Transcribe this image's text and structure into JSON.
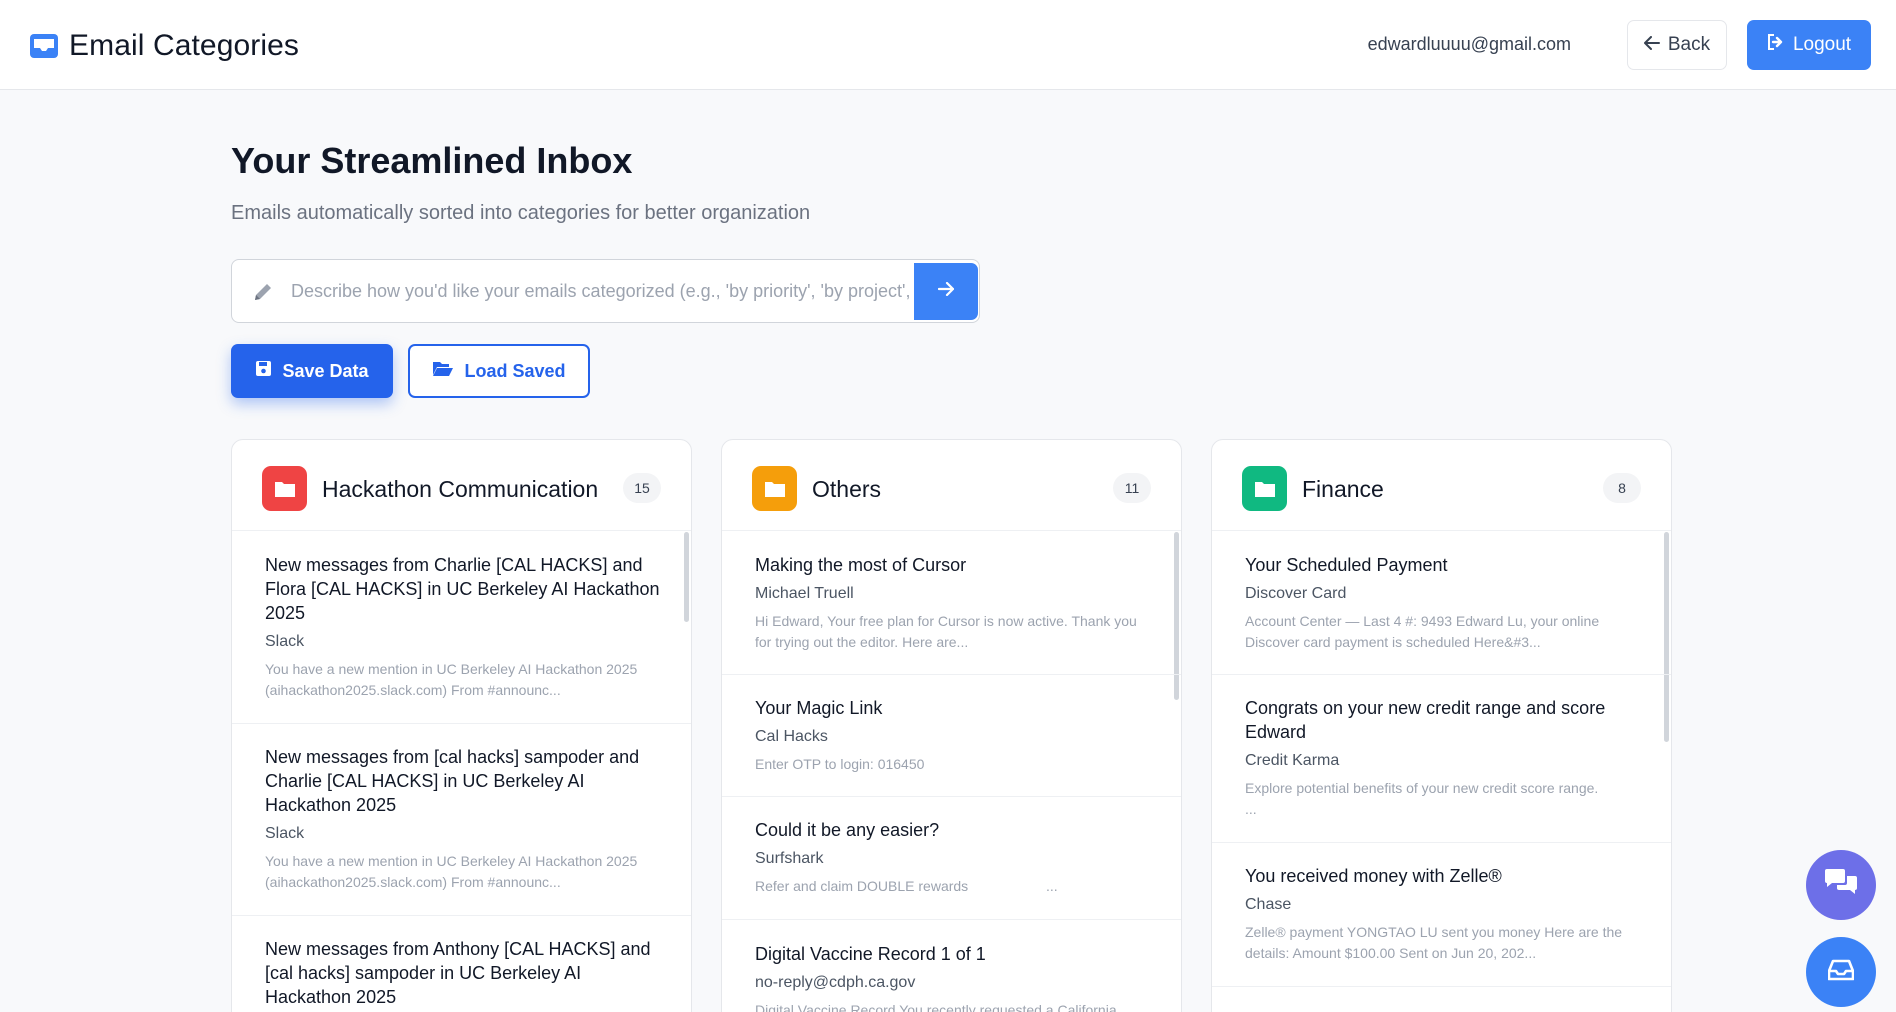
{
  "header": {
    "app_title": "Email Categories",
    "app_icon": "inbox-icon",
    "user_email": "edwardluuuu@gmail.com",
    "back_label": "Back",
    "logout_label": "Logout",
    "accent_color": "#3b82f6"
  },
  "main": {
    "title": "Your Streamlined Inbox",
    "subtitle": "Emails automatically sorted into categories for better organization",
    "prompt_placeholder": "Describe how you'd like your emails categorized (e.g., 'by priority', 'by project', 'by sender')",
    "prompt_value": "",
    "save_label": "Save Data",
    "load_label": "Load Saved"
  },
  "categories": [
    {
      "name": "Hackathon Communication",
      "count": "15",
      "color": "#ef4444",
      "icon": "folder-icon",
      "emails": [
        {
          "subject": "New messages from Charlie [CAL HACKS] and Flora [CAL HACKS] in UC Berkeley AI Hackathon 2025",
          "sender": "Slack",
          "snippet": "You have a new mention in UC Berkeley AI Hackathon 2025 (aihackathon2025.slack.com) From #announc..."
        },
        {
          "subject": "New messages from [cal hacks] sampoder and Charlie [CAL HACKS] in UC Berkeley AI Hackathon 2025",
          "sender": "Slack",
          "snippet": "You have a new mention in UC Berkeley AI Hackathon 2025 (aihackathon2025.slack.com) From #announc..."
        },
        {
          "subject": "New messages from Anthony [CAL HACKS] and [cal hacks] sampoder in UC Berkeley AI Hackathon 2025",
          "sender": "",
          "snippet": ""
        }
      ]
    },
    {
      "name": "Others",
      "count": "11",
      "color": "#f59e0b",
      "icon": "folder-icon",
      "emails": [
        {
          "subject": "Making the most of Cursor",
          "sender": "Michael Truell",
          "snippet": "Hi Edward, Your free plan for Cursor is now active. Thank you for trying out the editor. Here are..."
        },
        {
          "subject": "Your Magic Link",
          "sender": "Cal Hacks",
          "snippet": "Enter OTP to login: 016450"
        },
        {
          "subject": "Could it be any easier?",
          "sender": "Surfshark",
          "snippet": "Refer and claim DOUBLE rewards                    ..."
        },
        {
          "subject": "Digital Vaccine Record 1 of 1",
          "sender": "no-reply@cdph.ca.gov",
          "snippet": "Digital Vaccine Record You recently requested a California"
        }
      ]
    },
    {
      "name": "Finance",
      "count": "8",
      "color": "#10b981",
      "icon": "folder-icon",
      "emails": [
        {
          "subject": "Your Scheduled Payment",
          "sender": "Discover Card",
          "snippet": "Account Center — Last 4 #: 9493 Edward Lu, your online Discover card payment is scheduled Here&#3..."
        },
        {
          "subject": "Congrats on your new credit range and score Edward",
          "sender": "Credit Karma",
          "snippet": "Explore potential benefits of your new credit score range.                ..."
        },
        {
          "subject": "You received money with Zelle®",
          "sender": "Chase",
          "snippet": "Zelle® payment YONGTAO LU sent you money Here are the details: Amount $100.00 Sent on Jun 20, 202..."
        }
      ]
    }
  ],
  "fabs": {
    "chat_icon": "chat-bubbles-icon",
    "inbox_icon": "inbox-icon",
    "chat_color": "#6d6fe8",
    "inbox_color": "#3b82f6"
  }
}
